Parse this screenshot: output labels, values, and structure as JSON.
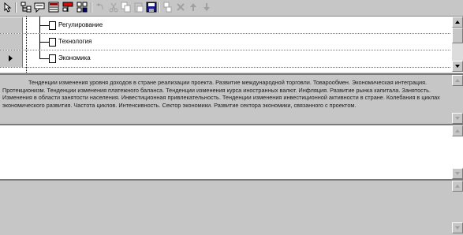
{
  "toolbar": {
    "icons": [
      "pointer-icon",
      "tree-view-icon",
      "comment-icon",
      "list-icon",
      "flag-icon",
      "table-icon",
      "undo-icon",
      "cut-icon",
      "copy-icon",
      "paste-icon",
      "save-icon",
      "move-icon",
      "delete-icon",
      "move-up-icon",
      "move-down-icon"
    ]
  },
  "tree": {
    "rows": [
      {
        "label": "Регулирование",
        "selected": false
      },
      {
        "label": "Технология",
        "selected": false
      },
      {
        "label": "Экономика",
        "selected": true
      }
    ]
  },
  "description": {
    "text": "Тенденции изменения уровня доходов в стране реализации проекта. Развитие международной торговли. Товарообмен. Экономическая интеграция. Протекционизм. Тенденции изменения платежного баланса. Тенденции изменения курса иностранных валют. Инфляция. Развитие рынка капитала. Занятость. Изменения в области занятости населения. Инвестиционная привлекательность. Тенденции изменения инвестиционной активности в стране. Колебания в циклах экономического развития. Частота циклов. Интенсивность. Сектор экономики. Развитие сектора экономики, связанного с проектом."
  },
  "editor": {
    "text": ""
  },
  "colors": {
    "panel": "#c6c6c6",
    "white": "#ffffff",
    "border": "#7a7a7a"
  }
}
